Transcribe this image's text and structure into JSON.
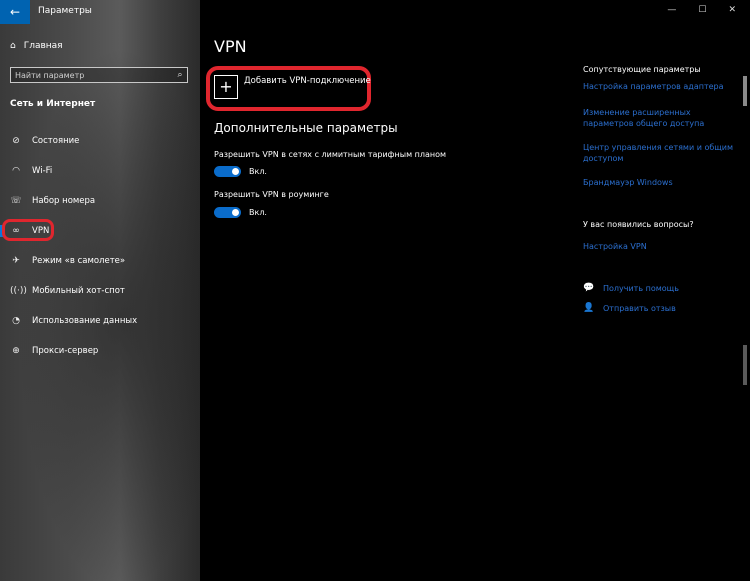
{
  "window": {
    "title": "Параметры",
    "controls": {
      "minimize": "—",
      "maximize": "☐",
      "close": "✕"
    }
  },
  "sidebar": {
    "home": "Главная",
    "search_placeholder": "Найти параметр",
    "section": "Сеть и Интернет",
    "items": [
      {
        "label": "Состояние",
        "icon": "status-icon"
      },
      {
        "label": "Wi-Fi",
        "icon": "wifi-icon"
      },
      {
        "label": "Набор номера",
        "icon": "dialup-icon"
      },
      {
        "label": "VPN",
        "icon": "vpn-icon",
        "selected": true
      },
      {
        "label": "Режим «в самолете»",
        "icon": "airplane-icon"
      },
      {
        "label": "Мобильный хот-спот",
        "icon": "hotspot-icon"
      },
      {
        "label": "Использование данных",
        "icon": "data-usage-icon"
      },
      {
        "label": "Прокси-сервер",
        "icon": "globe-icon"
      }
    ]
  },
  "main": {
    "title": "VPN",
    "add_vpn": "Добавить VPN-подключение",
    "advanced_header": "Дополнительные параметры",
    "options": [
      {
        "label": "Разрешить VPN в сетях с лимитным тарифным планом",
        "toggle_text": "Вкл."
      },
      {
        "label": "Разрешить VPN в роуминге",
        "toggle_text": "Вкл."
      }
    ]
  },
  "related": {
    "header": "Сопутствующие параметры",
    "links": [
      "Настройка параметров адаптера",
      "Изменение расширенных параметров общего доступа",
      "Центр управления сетями и общим доступом",
      "Брандмауэр Windows"
    ],
    "questions_header": "У вас появились вопросы?",
    "questions_link": "Настройка VPN",
    "help": "Получить помощь",
    "feedback": "Отправить отзыв"
  },
  "colors": {
    "accent": "#0a6ccb",
    "highlight": "#e0262e",
    "link": "#2b6fcf"
  }
}
